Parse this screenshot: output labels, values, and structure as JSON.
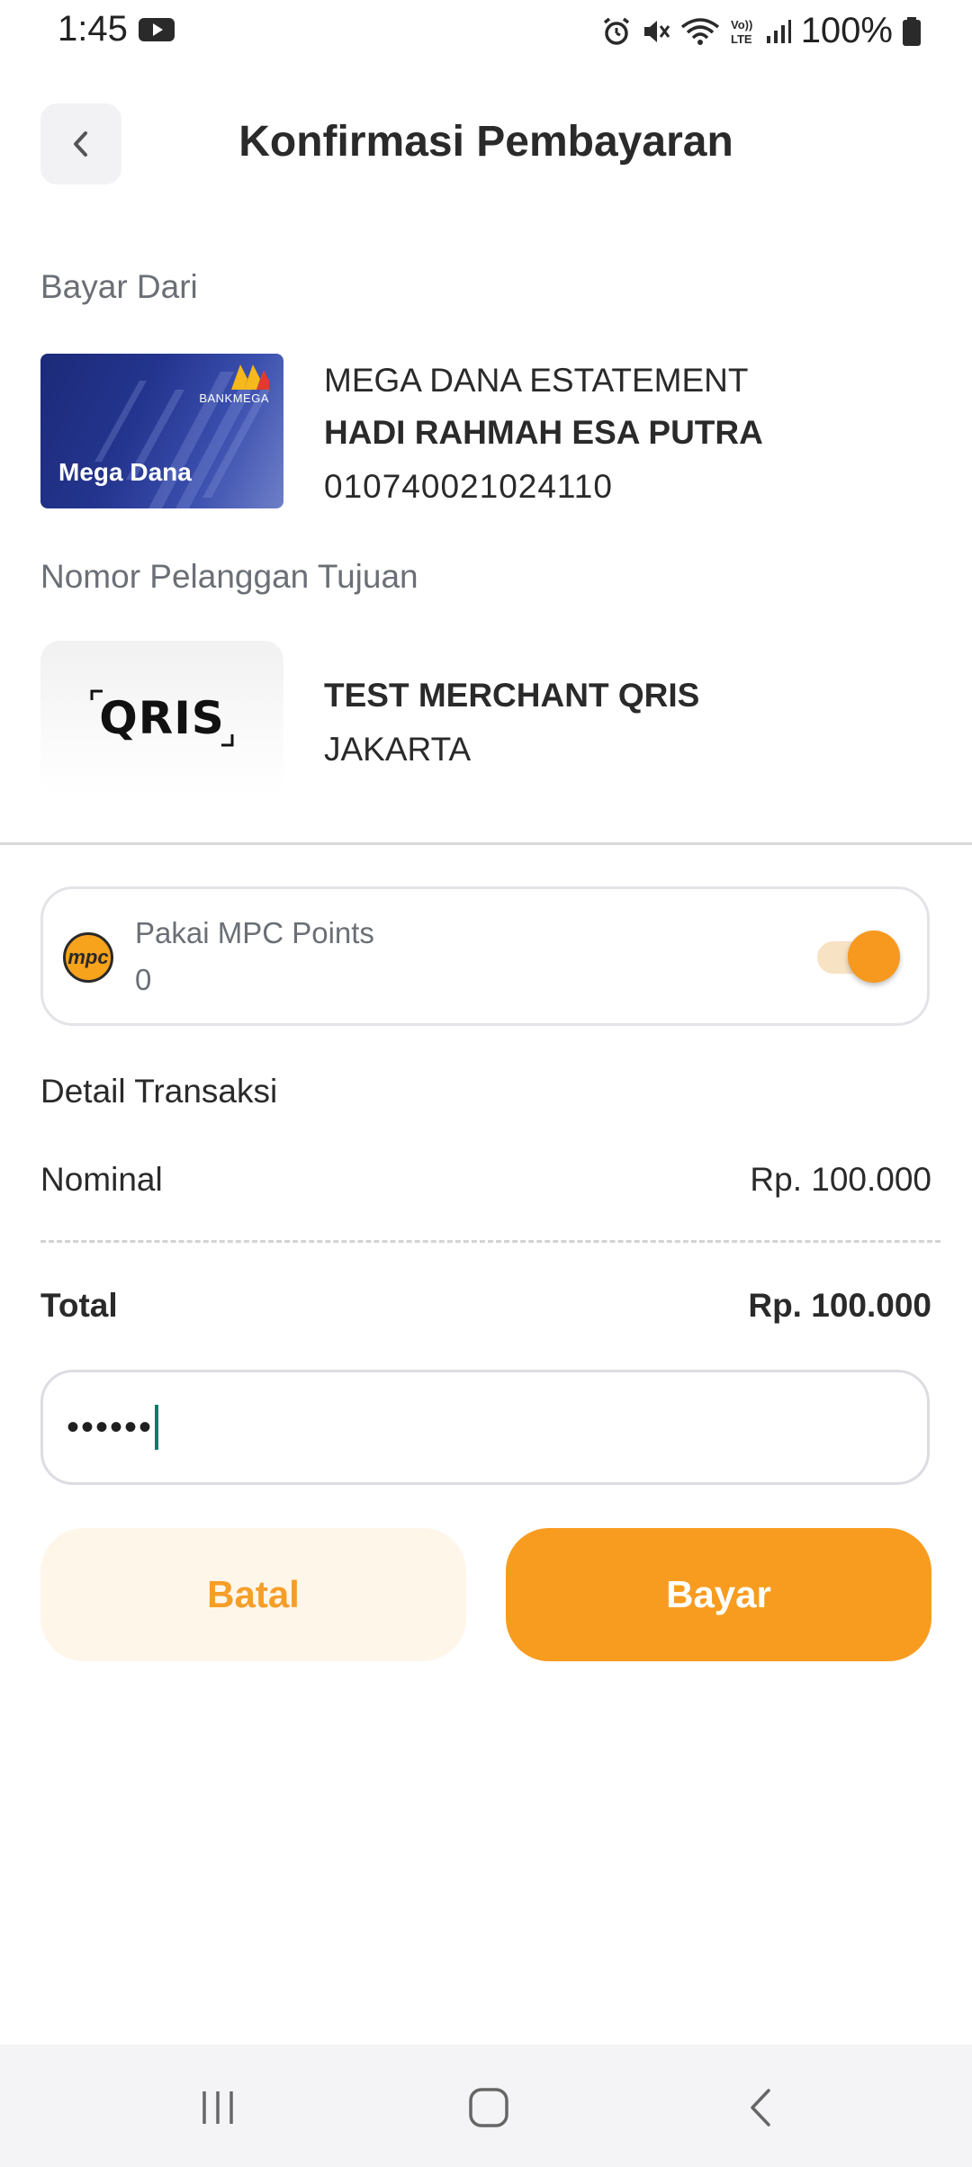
{
  "status_bar": {
    "time": "1:45",
    "battery": "100%"
  },
  "header": {
    "title": "Konfirmasi Pembayaran",
    "back_icon": "chevron-left-icon"
  },
  "source": {
    "label": "Bayar Dari",
    "card_name": "Mega Dana",
    "card_bank": "BANKMEGA",
    "account_type": "MEGA DANA ESTATEMENT",
    "account_holder": "HADI RAHMAH ESA PUTRA",
    "account_number": "010740021024110"
  },
  "destination": {
    "label": "Nomor Pelanggan Tujuan",
    "logo_text": "QRIS",
    "merchant_name": "TEST MERCHANT QRIS",
    "merchant_city": "JAKARTA"
  },
  "mpc": {
    "logo_text": "mpc",
    "label": "Pakai MPC Points",
    "value": "0",
    "toggle_on": true,
    "accent": "#f7991f"
  },
  "detail": {
    "title": "Detail Transaksi",
    "nominal_label": "Nominal",
    "nominal_value": "Rp. 100.000",
    "total_label": "Total",
    "total_value": "Rp. 100.000"
  },
  "pin": {
    "value": "••••••"
  },
  "buttons": {
    "cancel_label": "Batal",
    "pay_label": "Bayar",
    "primary_color": "#f89c20"
  }
}
